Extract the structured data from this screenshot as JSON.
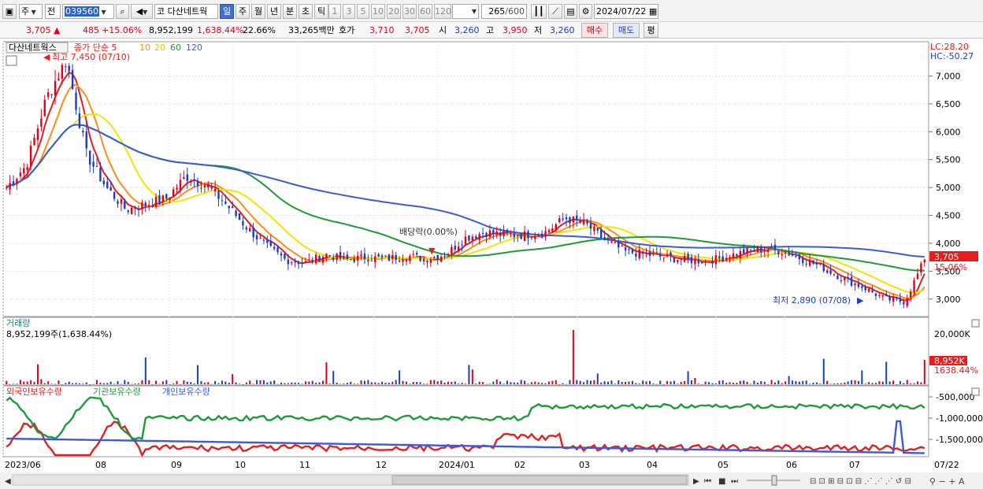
{
  "toolbar": {
    "market": "주",
    "period_type": "전",
    "code": "039560",
    "stock_name_prefix": "코",
    "stock_name": "다산네트웍",
    "intervals": [
      "일",
      "주",
      "월",
      "년",
      "분",
      "초",
      "틱"
    ],
    "selected_interval": "일",
    "minute_steps": [
      "1",
      "3",
      "5",
      "10",
      "20",
      "30",
      "60",
      "120"
    ],
    "count": "265",
    "count_max": "/600",
    "date": "2024/07/22"
  },
  "quote": {
    "price": "3,705",
    "change": "485",
    "change_pct": "+15.06%",
    "volume": "8,952,199",
    "volume_pct": "1,638.44%",
    "turnover_pct": "22.66%",
    "amount": "33,265백만",
    "bid_label": "호가",
    "bid1": "3,710",
    "bid2": "3,705",
    "open_label": "시",
    "open": "3,260",
    "high_label": "고",
    "high": "3,950",
    "low_label": "저",
    "low": "3,260",
    "buy_label": "매수",
    "sell_label": "매도",
    "eval_label": "평"
  },
  "price_panel": {
    "title": "다산네트웍스",
    "ma_label": "종가 단순 5",
    "ma10": "10",
    "ma20": "20",
    "ma60": "60",
    "ma120": "120",
    "high_marker": "최고 7,450 (07/10)",
    "low_marker": "최저 2,890 (07/08)",
    "dividend_marker": "배당락(0.00%)",
    "lc": "LC:28.20",
    "hc": "HC:-50.27",
    "current_tag": "3,705",
    "current_pct": "15.06%",
    "y_ticks": [
      "7,000",
      "6,500",
      "6,000",
      "5,500",
      "5,000",
      "4,500",
      "4,000",
      "3,500",
      "3,000"
    ]
  },
  "volume_panel": {
    "title": "거래량",
    "value_label": "8,952,199주(1,638.44%)",
    "y_tick": "20,000K",
    "tag": "8,952K",
    "tag_pct": "1638.44%"
  },
  "holding_panel": {
    "foreign": "외국인보유수량",
    "institution": "기관보유수량",
    "individual": "개인보유수량",
    "y_ticks": [
      "-500,000",
      "-1,000,000",
      "-1,500,000"
    ]
  },
  "x_labels": [
    "2023/06",
    "08",
    "09",
    "10",
    "11",
    "12",
    "2024/01",
    "02",
    "03",
    "04",
    "05",
    "06",
    "07",
    "07/22"
  ],
  "colors": {
    "up": "#e0001b",
    "down": "#1a3cc8",
    "ma5": "#e02020",
    "ma10": "#ff8c1a",
    "ma20": "#f2e600",
    "ma60": "#1f9a3a",
    "ma120": "#3b5bd9",
    "foreign": "#e02020",
    "institution": "#1f9a3a",
    "individual": "#3b5bd9"
  },
  "chart_data": {
    "type": "candlestick",
    "title": "다산네트웍스",
    "ylim": [
      2700,
      7600
    ],
    "months": [
      "2023/06",
      "08",
      "09",
      "10",
      "11",
      "12",
      "2024/01",
      "02",
      "03",
      "04",
      "05",
      "06",
      "07"
    ],
    "approx_closes": [
      5000,
      5400,
      6600,
      7300,
      5600,
      5000,
      4600,
      4700,
      4800,
      5200,
      5050,
      4700,
      4300,
      3950,
      3700,
      3650,
      3800,
      3700,
      3750,
      3720,
      3780,
      3720,
      3800,
      4100,
      4200,
      4150,
      4150,
      4200,
      4450,
      4350,
      4050,
      3850,
      3800,
      3750,
      3700,
      3680,
      3750,
      3850,
      3900,
      3850,
      3700,
      3550,
      3350,
      3200,
      3000,
      2950,
      3705
    ],
    "high": {
      "value": 7450,
      "date": "07/10"
    },
    "low": {
      "value": 2890,
      "date": "07/08"
    },
    "last": 3705,
    "volume_last": 8952199
  }
}
